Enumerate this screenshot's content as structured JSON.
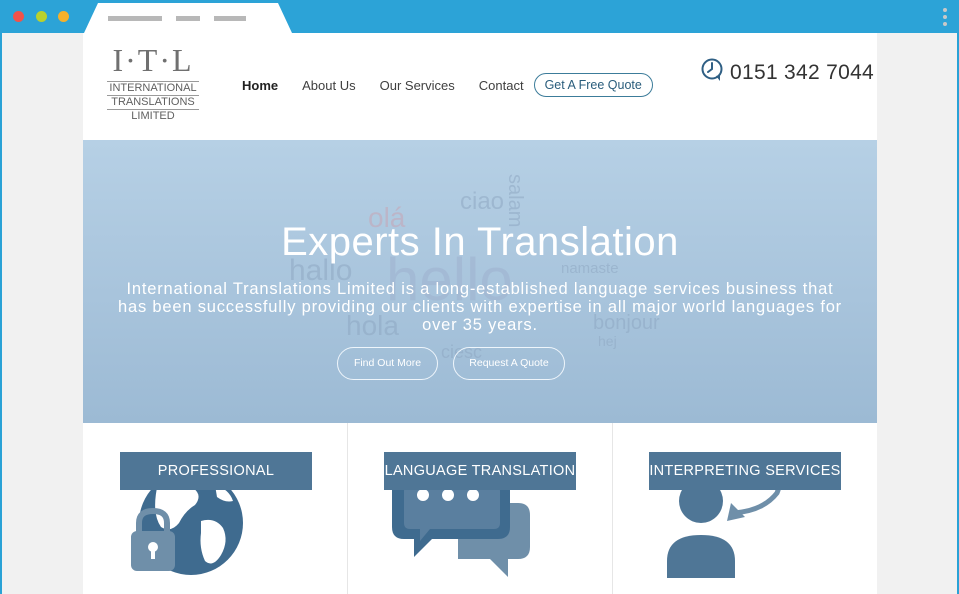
{
  "browser": {
    "tab_icon": "tab-placeholder",
    "menu_icon": "vertical-dots-icon"
  },
  "logo": {
    "mark": "I·T·L",
    "line1": "INTERNATIONAL",
    "line2": "TRANSLATIONS",
    "line3": "LIMITED"
  },
  "nav": {
    "items": [
      {
        "label": "Home"
      },
      {
        "label": "About Us"
      },
      {
        "label": "Our Services"
      },
      {
        "label": "Contact"
      }
    ],
    "quote_label": "Get A Free Quote"
  },
  "phone": {
    "number": "0151 342 7044",
    "icon": "phone-clock-icon"
  },
  "hero": {
    "title": "Experts In Translation",
    "description": "International Translations Limited is a long-established language services business that has been successfully providing our clients with expertise in all major world languages for over 35 years.",
    "find_out_more": "Find Out More",
    "request_quote": "Request A Quote",
    "background_words": [
      "hello",
      "ciao",
      "olá",
      "hallo",
      "hola",
      "salam",
      "namaste",
      "bonjour",
      "hej",
      "ciesc"
    ]
  },
  "features": [
    {
      "label": "PROFESSIONAL",
      "icon": "globe-lock-icon"
    },
    {
      "label": "LANGUAGE TRANSLATION",
      "icon": "speech-bubbles-icon"
    },
    {
      "label": "INTERPRETING SERVICES",
      "icon": "person-speech-icon"
    }
  ],
  "colors": {
    "chrome": "#2ca3d7",
    "hero": "#a9c6de",
    "accent": "#4f7696"
  }
}
